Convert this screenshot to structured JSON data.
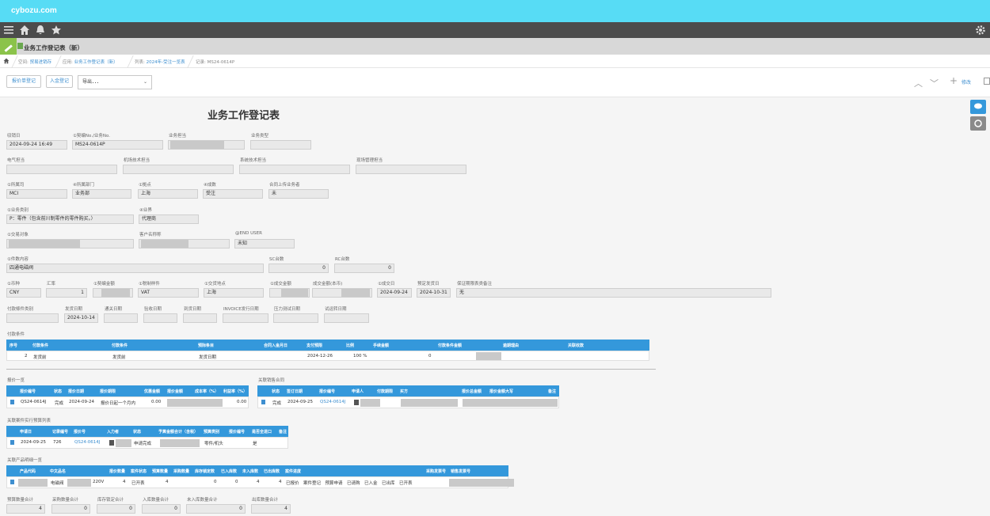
{
  "header": {
    "brand": "cybozu.com"
  },
  "app": {
    "title": "业务工作登记表（新）"
  },
  "breadcrumb": [
    {
      "prefix": "空间:",
      "label": "贸易进销存"
    },
    {
      "prefix": "应用:",
      "label": "业务工作登记表（新）"
    },
    {
      "prefix": "列表:",
      "label": "2024年-受注一览表"
    },
    {
      "prefix": "记录:",
      "label": "MS24-0614P"
    }
  ],
  "toolbar": {
    "btn1": "报价单登记",
    "btn2": "入金登记",
    "select": "导出．．．",
    "edit": "修改"
  },
  "form": {
    "title": "业务工作登记表",
    "f_date_lbl": "収销日",
    "f_date": "2024-09-24 16:49",
    "f_no_lbl": "①契编No./业务No.",
    "f_no": "MS24-0614P",
    "f_staff_lbl": "业务担当",
    "f_type_lbl": "业务类型",
    "f_elec_lbl": "电气担当",
    "f_mech_lbl": "机场技术担当",
    "f_sys_lbl": "系统技术担当",
    "f_site_lbl": "现场管理担当",
    "f_co_lbl": "①所属司",
    "f_co": "MCI",
    "f_dept_lbl": "④所属部门",
    "f_dept": "业务部",
    "f_base_lbl": "①拠点",
    "f_base": "上海",
    "f_stage_lbl": "④成数",
    "f_stage": "受注",
    "f_contract_lbl": "合同上传业务者",
    "f_contract": "未",
    "f_cat_lbl": "①业务类别",
    "f_cat": "P：零件（包含前川制零件的零件购买。）",
    "f_biz_lbl": "④业界",
    "f_biz": "代理商",
    "f_partner_lbl": "①交易对象",
    "f_customer_lbl": "客户名称称",
    "f_enduser_lbl": "@END USER",
    "f_enduser": "未知",
    "f_content_lbl": "①件数内容",
    "f_content": "四通电磁阀",
    "f_sc_lbl": "SC台数",
    "f_sc": "0",
    "f_rc_lbl": "RC台数",
    "f_rc": "0",
    "f_cur_lbl": "①币种",
    "f_cur": "CNY",
    "f_rate_lbl": "汇率",
    "f_rate": "1",
    "f_amount_lbl": "①契编金额",
    "f_tax_lbl": "①税制样件",
    "f_tax": "VAT",
    "f_place_lbl": "①交货地点",
    "f_place": "上海",
    "f_deal_lbl": "①成交金额",
    "f_deal_local_lbl": "成交金额(本币)",
    "f_deal_date_lbl": "①成交日",
    "f_deal_date": "2024-09-24",
    "f_plan_lbl": "预定发货日",
    "f_plan": "2024-10-31",
    "f_warranty_lbl": "保证期限表类备注",
    "f_warranty": "无",
    "f_pay_lbl": "付款條件类别",
    "f_ship_lbl": "发货日期",
    "f_ship": "2024-10-14",
    "f_customs_lbl": "通关日期",
    "f_receive_lbl": "验收日期",
    "f_arrive_lbl": "到货日期",
    "f_invoice_lbl": "INVOICE发行日期",
    "f_pressure_lbl": "压力测试日期",
    "f_trial_lbl": "试运转日期"
  },
  "pay_table": {
    "title": "付款条件",
    "headers": [
      "序号",
      "付款条件",
      "付款条件",
      "预际条目",
      "合同入金月日",
      "支付预限",
      "比例",
      "手续金额",
      "付款条件金额",
      "逾期理由",
      "关联收款"
    ],
    "row": {
      "no": "2",
      "cond": "发货前",
      "cond2": "发货前",
      "item": "发货日期",
      "date": "2024-12-26",
      "ratio": "100 %",
      "fee": "0"
    }
  },
  "quote_table": {
    "title": "报价一览",
    "headers": [
      "报价编号",
      "状态",
      "报价日期",
      "报价期限",
      "优惠金额",
      "报价金额",
      "成本率（%）",
      "利益率（%）"
    ],
    "row": {
      "no": "QS24-0614J",
      "status": "完成",
      "date": "2024-09-24",
      "term": "报价日起一个月内",
      "discount": "0.00",
      "profit": "0.00"
    }
  },
  "sales_table": {
    "title": "关联销售合同",
    "headers": [
      "状态",
      "签订日期",
      "报价编号",
      "申请人",
      "付款期限",
      "买方",
      "报价总金额",
      "报价金额大写",
      "备注"
    ],
    "row": {
      "status": "完成",
      "date": "2024-09-25",
      "no": "QS24-0614J"
    }
  },
  "budget_table": {
    "title": "关联案件实行预算列表",
    "headers": [
      "申请日",
      "记录编号",
      "报价号",
      "入力者",
      "状态",
      "予算金额合计（含税）",
      "预算类别",
      "报价编号",
      "是否全进口",
      "备注"
    ],
    "row": {
      "date": "2024-09-25",
      "rec": "726",
      "no": "QS24-0614J",
      "status": "申请完成",
      "cat": "零件/机头",
      "imp": "是"
    }
  },
  "product_table": {
    "title": "关联产品明细一览",
    "headers": [
      "产品代码",
      "中文品名",
      "报价数量",
      "案件状态",
      "预算数量",
      "采购数量",
      "库存锁定数",
      "已入库数",
      "未入库数",
      "已出库数",
      "案件进度",
      "采购发票号",
      "销售发票号"
    ],
    "row": {
      "name": "电磁阀",
      "v": "220V",
      "qty": "4",
      "status": "已开表",
      "budget": "4",
      "stock": "0",
      "in": "0",
      "notin": "4",
      "out": "4",
      "progress": "已报价　案件登记　预算申请　已请购　已入金　已出库　已开表"
    }
  },
  "totals": [
    {
      "label": "预算数量合计",
      "value": "4"
    },
    {
      "label": "采购数量合计",
      "value": "0"
    },
    {
      "label": "库存锁定合计",
      "value": "0"
    },
    {
      "label": "入库数量合计",
      "value": "0"
    },
    {
      "label": "未入库数量合计",
      "value": "0"
    },
    {
      "label": "出库数量合计",
      "value": "4"
    }
  ]
}
